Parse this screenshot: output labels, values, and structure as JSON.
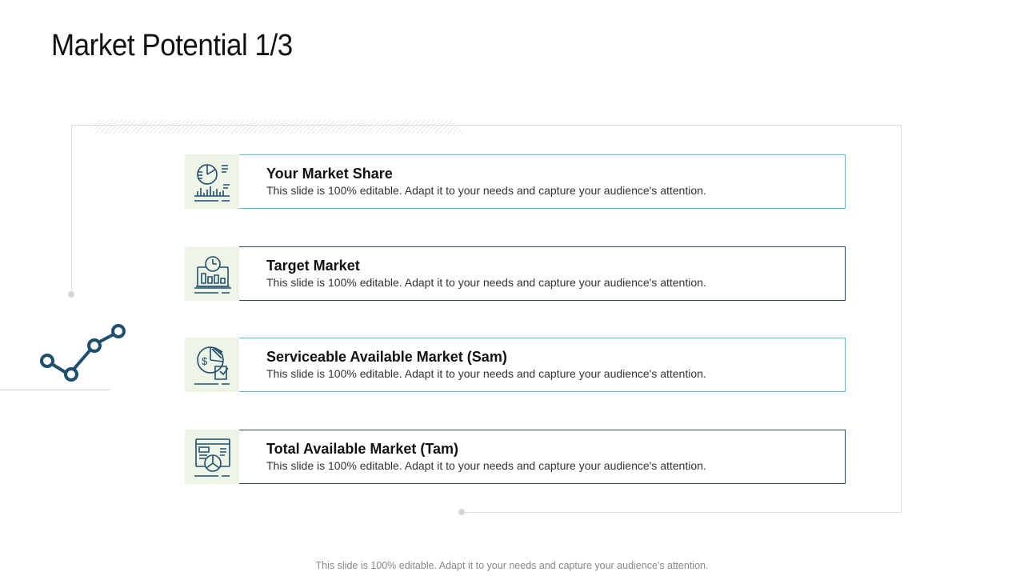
{
  "slide": {
    "title": "Market Potential 1/3",
    "footer": "This slide is 100% editable. Adapt it to your needs and capture your audience's attention."
  },
  "items": [
    {
      "heading": "Your Market Share",
      "desc": "This slide is 100% editable. Adapt it to your needs and capture your audience's attention.",
      "icon": "market-share-chart-icon"
    },
    {
      "heading": "Target Market",
      "desc": "This slide is 100% editable. Adapt it to your needs and capture your audience's attention.",
      "icon": "laptop-analytics-icon"
    },
    {
      "heading": "Serviceable Available Market (Sam)",
      "desc": "This slide is 100% editable. Adapt it to your needs and capture your audience's attention.",
      "icon": "pie-dollar-icon"
    },
    {
      "heading": "Total Available Market (Tam)",
      "desc": "This slide is 100% editable. Adapt it to your needs and capture your audience's attention.",
      "icon": "browser-pie-icon"
    }
  ],
  "colors": {
    "accent": "#1f4e6e",
    "light_border": "#5bbcd0",
    "icon_tile": "#eef5e6"
  }
}
